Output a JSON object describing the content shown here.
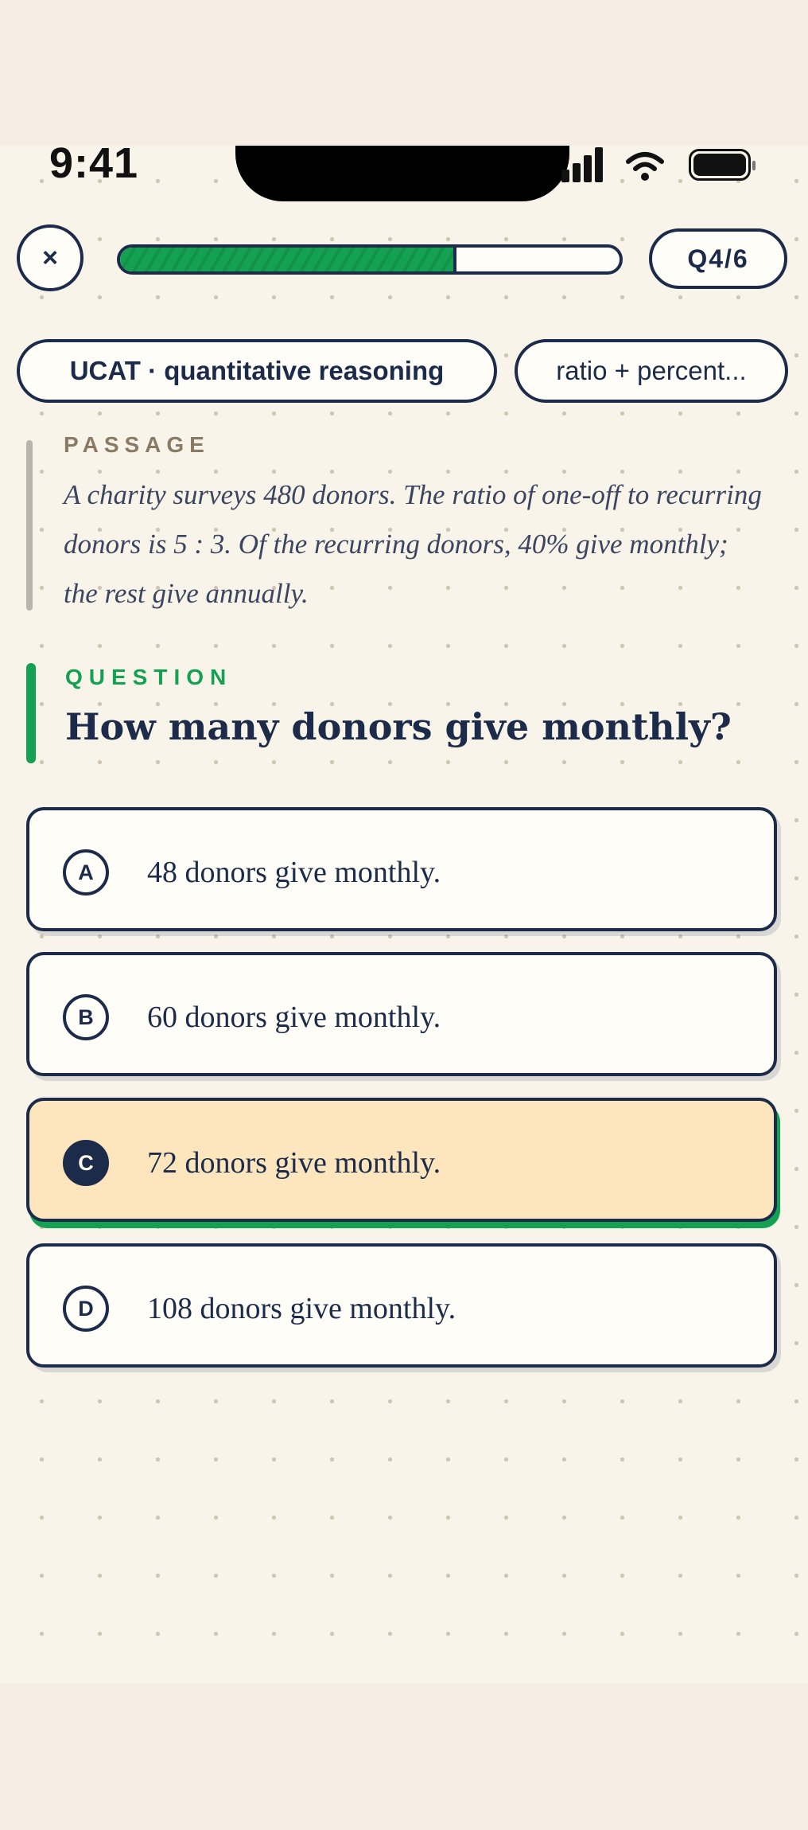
{
  "status_bar": {
    "time": "9:41"
  },
  "header": {
    "close_label": "×",
    "progress": {
      "current": 4,
      "total": 6,
      "fraction": 0.667
    },
    "question_counter": "Q4/6"
  },
  "chips": {
    "exam": "UCAT · quantitative reasoning",
    "topic": "ratio + percent..."
  },
  "passage": {
    "label": "PASSAGE",
    "text": "A charity surveys 480 donors. The ratio of one-off to recurring donors is 5 : 3. Of the recurring donors, 40% give monthly; the rest give annually."
  },
  "question": {
    "label": "QUESTION",
    "text": "How many donors give monthly?"
  },
  "options": [
    {
      "letter": "A",
      "text": "48 donors give monthly.",
      "selected": false
    },
    {
      "letter": "B",
      "text": "60 donors give monthly.",
      "selected": false
    },
    {
      "letter": "C",
      "text": "72 donors give monthly.",
      "selected": true
    },
    {
      "letter": "D",
      "text": "108 donors give monthly.",
      "selected": false
    }
  ],
  "colors": {
    "accent_green": "#14a152",
    "navy": "#1c2b4a",
    "selected_bg": "#fde6bd",
    "background": "#f9f4ea"
  },
  "icons": [
    "close-icon",
    "signal-icon",
    "wifi-icon",
    "battery-icon"
  ]
}
